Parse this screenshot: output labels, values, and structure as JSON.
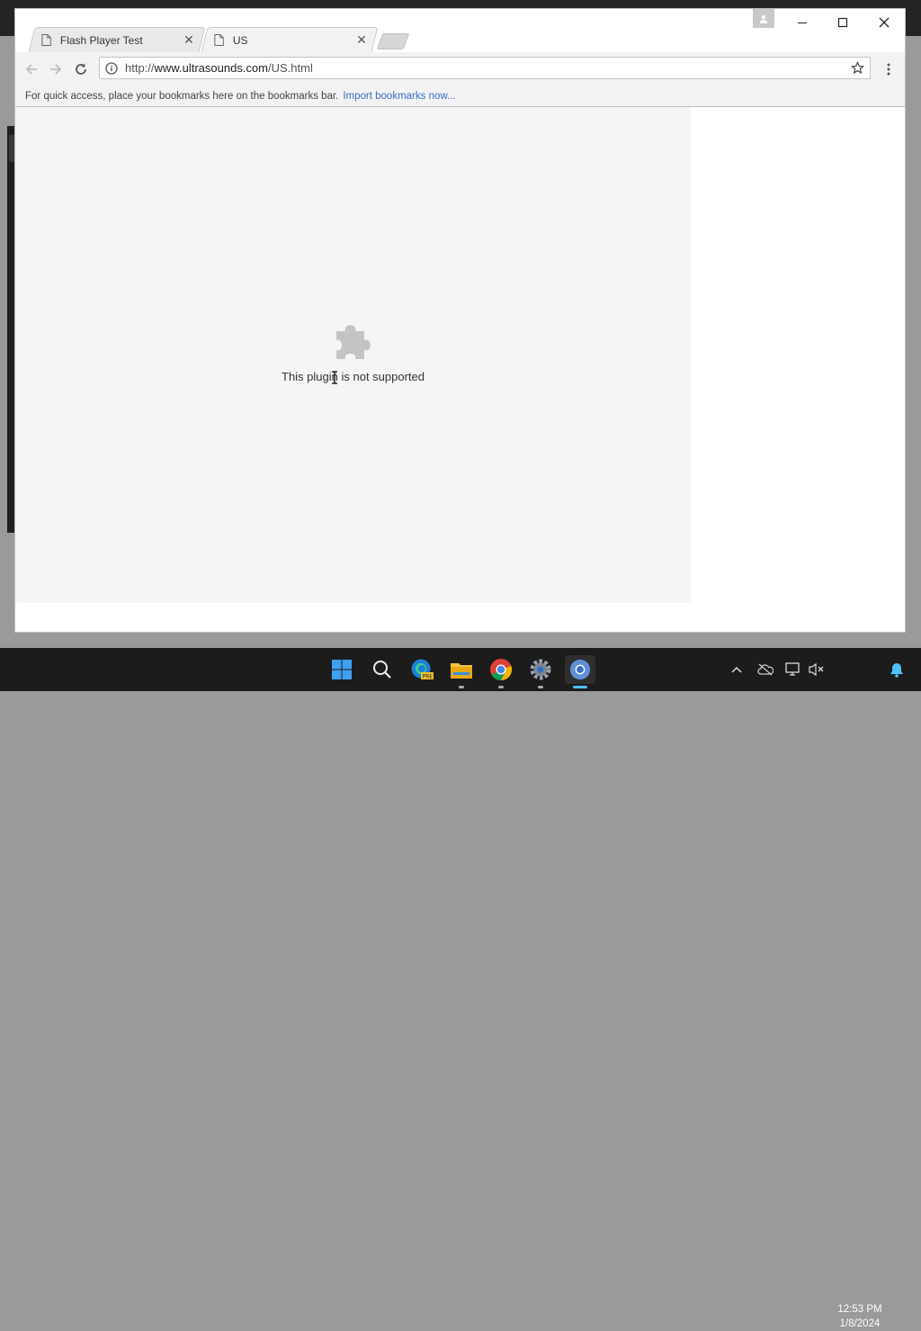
{
  "browser": {
    "tabs": [
      {
        "title": "Flash Player Test",
        "active": false
      },
      {
        "title": "US",
        "active": true
      }
    ],
    "address": {
      "scheme": "http://",
      "host": "www.ultrasounds.com",
      "path": "/US.html"
    },
    "bookmarks_bar": {
      "hint": "For quick access, place your bookmarks here on the bookmarks bar.",
      "import_link": "Import bookmarks now..."
    }
  },
  "page": {
    "plugin_message": "This plugin is not supported",
    "plugin_icon": "puzzle-piece-icon"
  },
  "taskbar": {
    "apps": [
      "start-icon",
      "search-icon",
      "edge-beta-icon",
      "file-explorer-icon",
      "chrome-icon",
      "settings-icon",
      "chromium-icon"
    ],
    "active_app": "chromium-icon",
    "tray": [
      "chevron-up-icon",
      "onedrive-icon",
      "network-icon",
      "volume-muted-icon",
      "notification-bell-icon"
    ],
    "time": "12:53 PM",
    "date": "1/8/2024"
  },
  "colors": {
    "accent": "#4cc2ff",
    "link": "#3b6ec2",
    "taskbar": "#1c1c1c"
  }
}
